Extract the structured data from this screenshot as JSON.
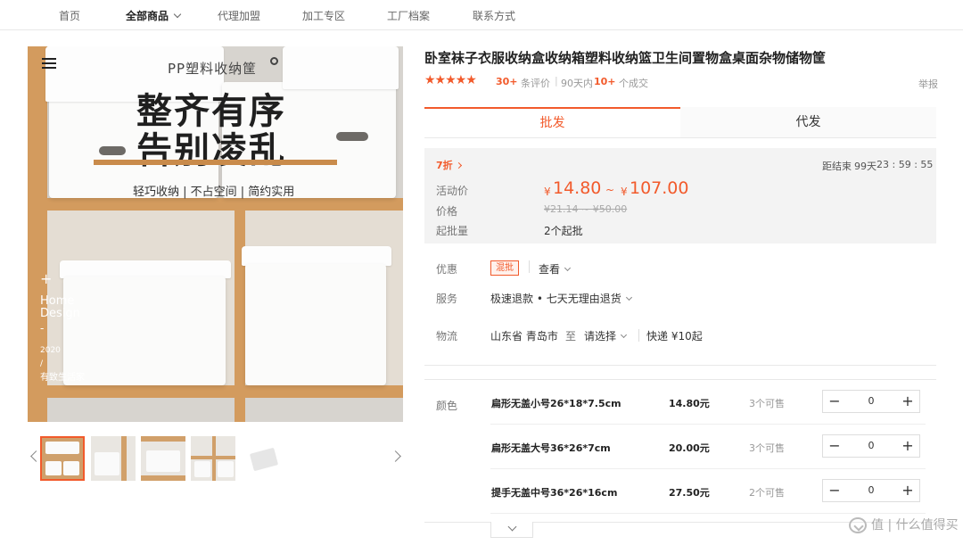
{
  "nav": {
    "items": [
      "首页",
      "全部商品",
      "代理加盟",
      "加工专区",
      "工厂档案",
      "联系方式"
    ],
    "active_index": 1
  },
  "image": {
    "subtitle": "PP塑料收纳筐",
    "title_line1": "整齐有序",
    "title_line2": "告别凌乱",
    "tagline": "轻巧收纳 | 不占空间 | 简约实用",
    "side_plus": "+",
    "side_home": "Home",
    "side_design": "Design",
    "side_dash": "-",
    "side_year": "2020",
    "side_slash": "/",
    "side_brand": "有致生活家",
    "thumb_count": 5,
    "selected_thumb": 1
  },
  "product": {
    "title": "卧室袜子衣服收纳盒收纳箱塑料收纳篮卫生间置物盒桌面杂物储物筐",
    "stars": "★★★★★",
    "rating": 5,
    "review_count": "30+",
    "review_label": "条评价",
    "sep": "|",
    "sold_label": "90天内",
    "sold_count": "10+",
    "sold_suffix": "个成交",
    "report": "举报"
  },
  "tabs": {
    "wholesale": "批发",
    "dropship": "代发",
    "active": "wholesale"
  },
  "price_panel": {
    "discount": "7折",
    "countdown_label": "距结束",
    "countdown_days": "99天",
    "countdown_time": "23 : 59 : 55",
    "promo_price_label": "活动价",
    "currency": "¥",
    "promo_low": "14.80",
    "tilde": "~",
    "promo_high": "107.00",
    "price_label": "价格",
    "original_range": "¥21.14 ~ ¥50.00",
    "min_order_label": "起批量",
    "min_order": "2个起批"
  },
  "details": {
    "promo_label": "优惠",
    "promo_tag": "混批",
    "promo_view": "查看",
    "service_label": "服务",
    "service_value": "极速退款 • 七天无理由退货",
    "logistics_label": "物流",
    "from": "山东省 青岛市",
    "to_word": "至",
    "to_select": "请选择",
    "shipping": "快递 ¥10起"
  },
  "sku": {
    "label": "颜色",
    "items": [
      {
        "name": "扁形无盖小号26*18*7.5cm",
        "price": "14.80元",
        "stock": "3个可售",
        "qty": "0"
      },
      {
        "name": "扁形无盖大号36*26*7cm",
        "price": "20.00元",
        "stock": "3个可售",
        "qty": "0"
      },
      {
        "name": "提手无盖中号36*26*16cm",
        "price": "27.50元",
        "stock": "2个可售",
        "qty": "0"
      }
    ],
    "minus": "−",
    "plus": "+"
  },
  "watermark": "值 | 什么值得买",
  "colors": {
    "accent": "#f25a2b",
    "panel": "#f3f3f3"
  }
}
